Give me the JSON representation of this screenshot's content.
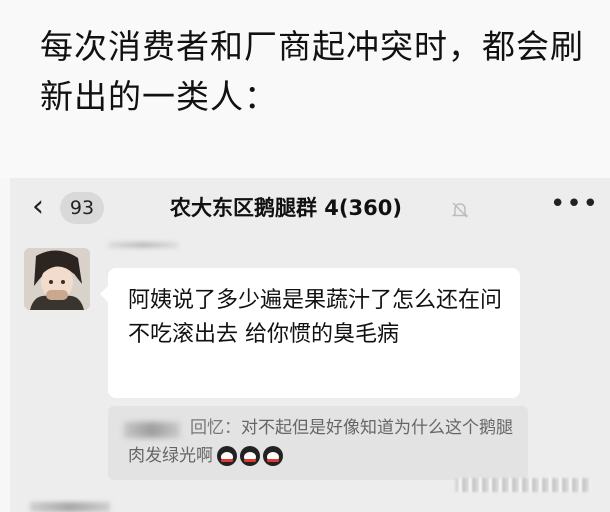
{
  "caption": {
    "text": "每次消费者和厂商起冲突时，都会刷新出的一类人："
  },
  "chat": {
    "back_icon": "chevron-left-icon",
    "unread_count": "93",
    "title": "农大东区鹅腿群 4(360)",
    "mute_icon": "bell-off-icon",
    "more_label": "•••"
  },
  "message": {
    "text": "阿姨说了多少遍是果蔬汁了怎么还在问 不吃滚出去 给你惯的臭毛病",
    "quote": {
      "author_suffix": "回忆：",
      "text": "对不起但是好像知道为什么这个鹅腿肉发绿光啊",
      "emoji_icon": "crying-laughing-emoji",
      "emoji_count": 3
    }
  },
  "colors": {
    "chat_background": "#ededed",
    "bubble_background": "#ffffff",
    "quote_background": "#e3e3e3"
  }
}
